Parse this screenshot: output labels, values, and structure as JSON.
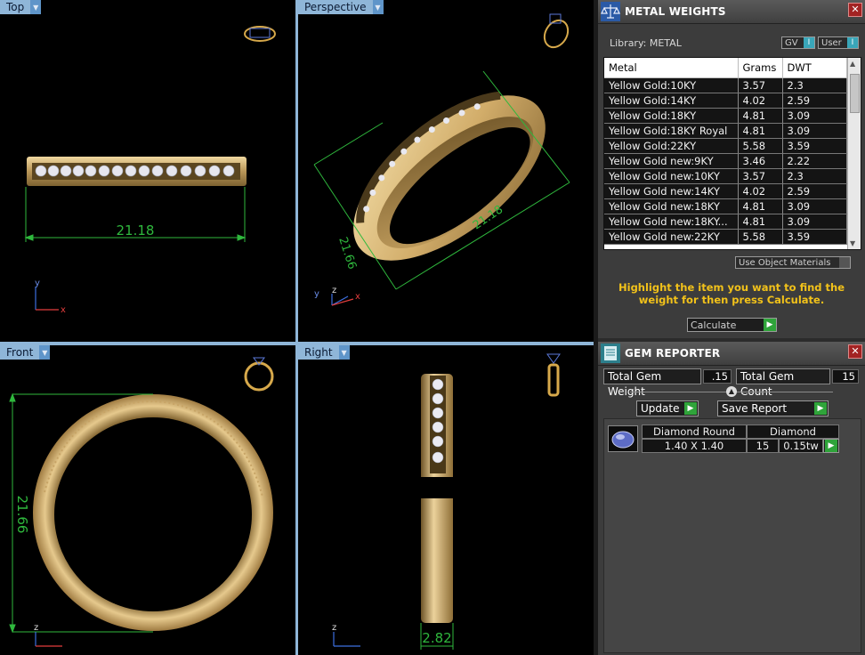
{
  "viewports": {
    "top": {
      "label": "Top",
      "dimension": "21.18"
    },
    "perspective": {
      "label": "Perspective",
      "dim_a": "21.66",
      "dim_b": "21.18"
    },
    "front": {
      "label": "Front",
      "dimension": "21.66"
    },
    "right": {
      "label": "Right",
      "dimension": "2.82"
    },
    "axes": {
      "x": "x",
      "y": "y",
      "z": "z"
    }
  },
  "metal_weights": {
    "title": "METAL WEIGHTS",
    "library_label": "Library: METAL",
    "gv_label": "GV",
    "user_label": "User",
    "toggle_indicator": "I",
    "columns": [
      "Metal",
      "Grams",
      "DWT"
    ],
    "rows": [
      [
        "Yellow Gold:10KY",
        "3.57",
        "2.3"
      ],
      [
        "Yellow Gold:14KY",
        "4.02",
        "2.59"
      ],
      [
        "Yellow Gold:18KY",
        "4.81",
        "3.09"
      ],
      [
        "Yellow Gold:18KY Royal",
        "4.81",
        "3.09"
      ],
      [
        "Yellow Gold:22KY",
        "5.58",
        "3.59"
      ],
      [
        "Yellow Gold new:9KY",
        "3.46",
        "2.22"
      ],
      [
        "Yellow Gold new:10KY",
        "3.57",
        "2.3"
      ],
      [
        "Yellow Gold new:14KY",
        "4.02",
        "2.59"
      ],
      [
        "Yellow Gold new:18KY",
        "4.81",
        "3.09"
      ],
      [
        "Yellow Gold new:18KY...",
        "4.81",
        "3.09"
      ],
      [
        "Yellow Gold new:22KY",
        "5.58",
        "3.59"
      ]
    ],
    "use_object_materials": "Use Object Materials",
    "instruction": "Highlight the item you want to find the weight for then press Calculate.",
    "calculate_label": "Calculate"
  },
  "gem_reporter": {
    "title": "GEM REPORTER",
    "total_weight_label": "Total Gem Weight",
    "total_weight_value": ".15",
    "total_count_label": "Total Gem Count",
    "total_count_value": "15",
    "update_label": "Update",
    "save_report_label": "Save Report",
    "gem": {
      "shape": "Diamond Round",
      "size": "1.40 X 1.40",
      "type": "Diamond",
      "count": "15",
      "weight": "0.15tw"
    }
  },
  "colors": {
    "gold": "#d9b777",
    "dimension_green": "#2fb83d",
    "accent_yellow": "#f2c21a",
    "viewport_tab": "#8fb6d8"
  }
}
